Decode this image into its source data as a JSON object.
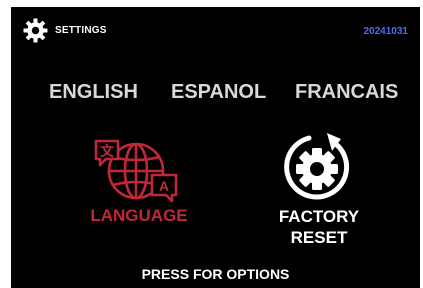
{
  "header": {
    "title": "SETTINGS",
    "version": "20241031",
    "icon": "gear-icon"
  },
  "languages": [
    {
      "label": "ENGLISH"
    },
    {
      "label": "ESPANOL"
    },
    {
      "label": "FRANCAIS"
    }
  ],
  "tiles": {
    "language": {
      "label": "LANGUAGE",
      "icon": "globe-speech-icon"
    },
    "factory_reset": {
      "line1": "FACTORY",
      "line2": "RESET",
      "icon": "gear-reset-icon"
    }
  },
  "footer": {
    "text": "PRESS FOR OPTIONS"
  },
  "colors": {
    "background": "#000000",
    "language_accent": "#c0283a",
    "version_text": "#4e6cf2",
    "language_buttons": "#d8d8d8"
  }
}
